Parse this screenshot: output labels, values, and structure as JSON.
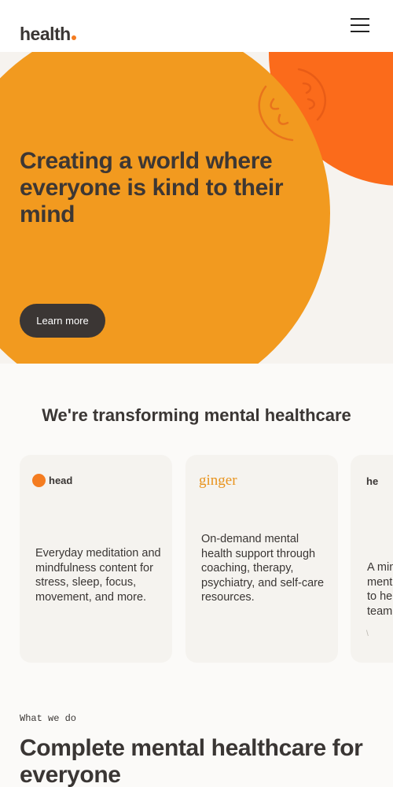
{
  "header": {
    "logo": "health",
    "menu_icon": "hamburger-menu-icon"
  },
  "hero": {
    "title": "Creating a world where everyone is kind to their mind",
    "cta_label": "Learn more",
    "colors": {
      "orange": "#f29a1f",
      "red_orange": "#fb6b1b",
      "background": "#f6f3ef"
    }
  },
  "transform": {
    "title": "We're transforming mental healthcare",
    "cards": [
      {
        "logo": "head",
        "text": "Everyday meditation and mindfulness content for stress, sleep, focus, movement, and more."
      },
      {
        "logo": "ginger",
        "text": "On-demand mental health support through coaching, therapy, psychiatry, and self-care resources."
      },
      {
        "logo": "he",
        "text": "A min\nment\nto he\nteam",
        "mark": "\\"
      }
    ]
  },
  "what_we_do": {
    "eyebrow": "What we do",
    "title": "Complete mental healthcare for everyone"
  }
}
